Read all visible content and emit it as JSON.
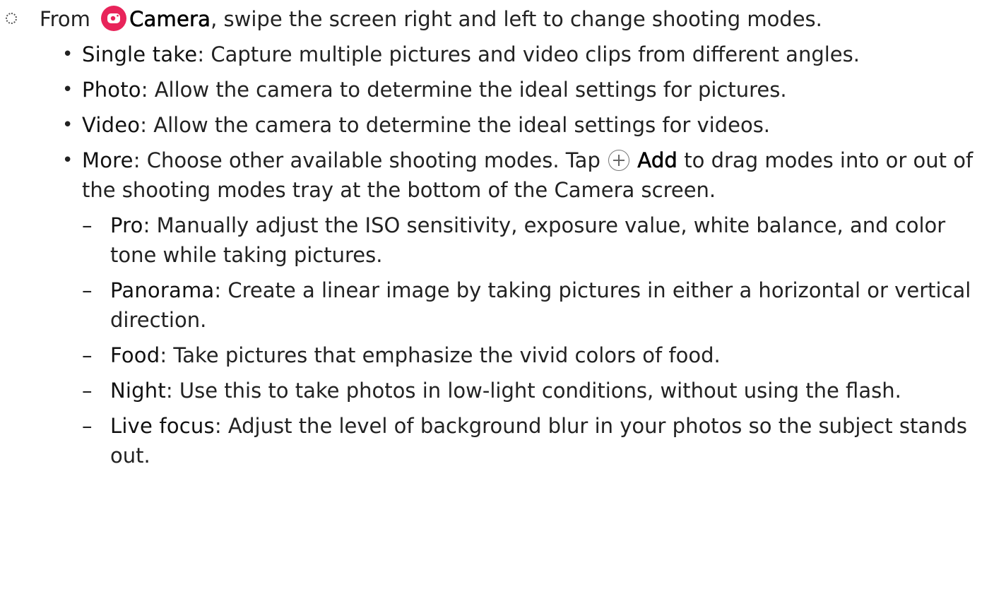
{
  "step": {
    "prefix": "From",
    "app_name": "Camera",
    "suffix": ", swipe the screen right and left to change shooting modes."
  },
  "modes": [
    {
      "name": "Single take",
      "desc": ": Capture multiple pictures and video clips from different angles."
    },
    {
      "name": "Photo",
      "desc": ": Allow the camera to determine the ideal settings for pictures."
    },
    {
      "name": "Video",
      "desc": ": Allow the camera to determine the ideal settings for videos."
    }
  ],
  "more": {
    "name": "More",
    "desc_before": ": Choose other available shooting modes. Tap",
    "add_label": "Add",
    "desc_after": "to drag modes into or out of the shooting modes tray at the bottom of the Camera screen."
  },
  "sub_modes": [
    {
      "name": "Pro",
      "desc": ": Manually adjust the ISO sensitivity, exposure value, white balance, and color tone while taking pictures."
    },
    {
      "name": "Panorama",
      "desc": ": Create a linear image by taking pictures in either a horizontal or vertical direction."
    },
    {
      "name": "Food",
      "desc": ": Take pictures that emphasize the vivid colors of food."
    },
    {
      "name": "Night",
      "desc": ": Use this to take photos in low-light conditions, without using the flash."
    },
    {
      "name": "Live focus",
      "desc": ": Adjust the level of background blur in your photos so the subject stands out."
    }
  ],
  "colors": {
    "camera_icon": "#e8245a",
    "text": "#222222"
  },
  "icons": {
    "step": "dotted-circle-icon",
    "app": "camera-app-icon",
    "add": "plus-circle-icon"
  }
}
